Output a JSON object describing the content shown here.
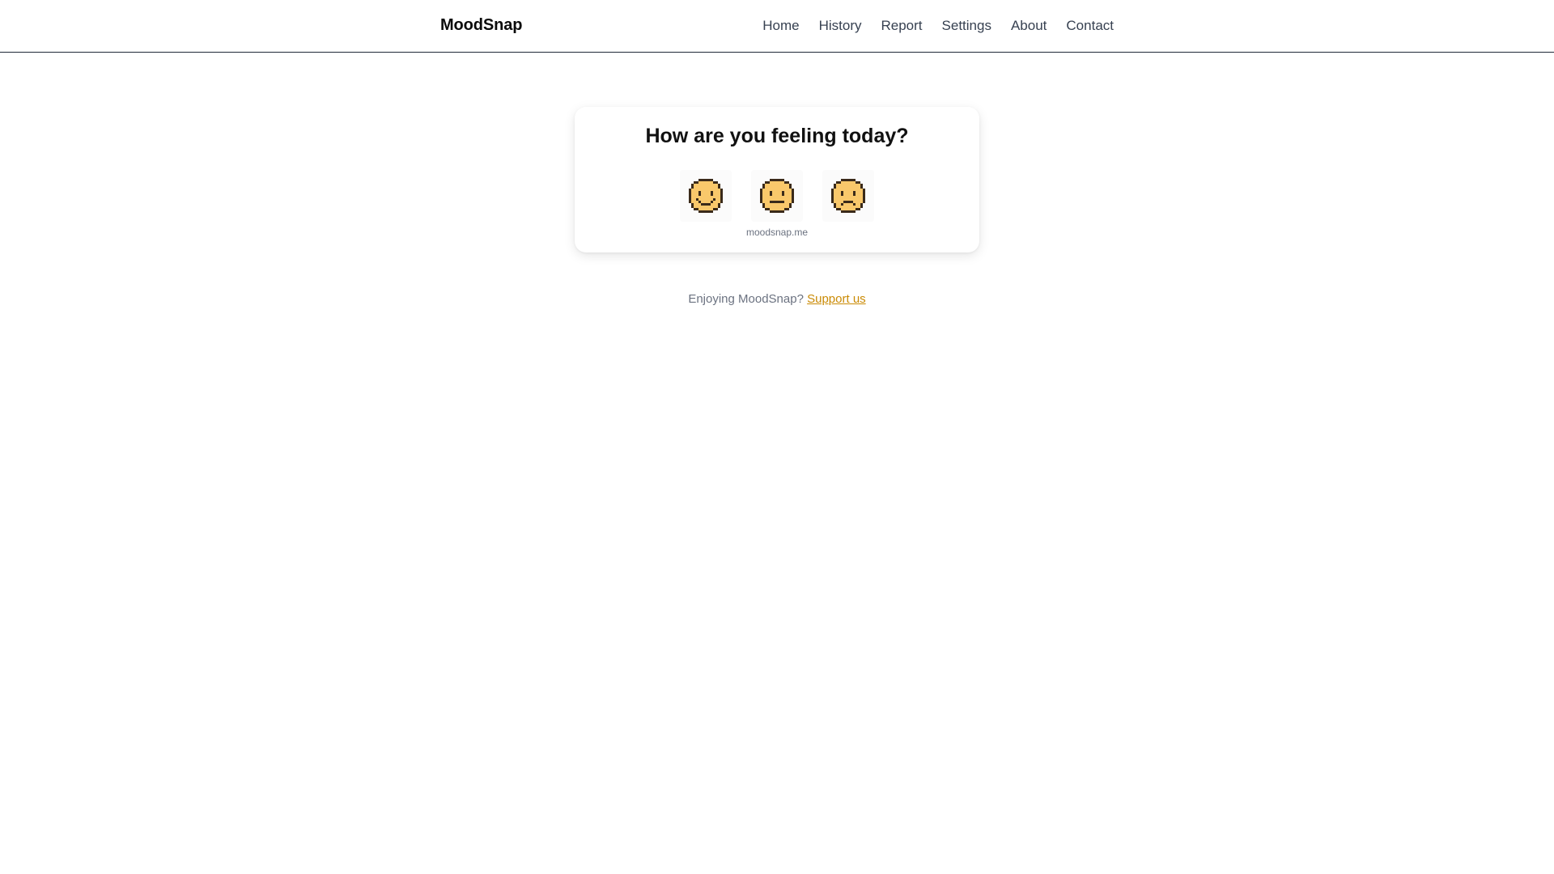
{
  "header": {
    "brand": "MoodSnap",
    "nav": [
      {
        "label": "Home"
      },
      {
        "label": "History"
      },
      {
        "label": "Report"
      },
      {
        "label": "Settings"
      },
      {
        "label": "About"
      },
      {
        "label": "Contact"
      }
    ]
  },
  "card": {
    "title": "How are you feeling today?",
    "moods": [
      {
        "icon": "happy-face-icon",
        "caption": ""
      },
      {
        "icon": "neutral-face-icon",
        "caption": "moodsnap.me"
      },
      {
        "icon": "sad-face-icon",
        "caption": ""
      }
    ]
  },
  "support": {
    "text": "Enjoying MoodSnap? ",
    "link_label": "Support us"
  },
  "colors": {
    "face_fill": "#f9c86b",
    "face_outline": "#3a2a1a",
    "link": "#ca8a04"
  }
}
